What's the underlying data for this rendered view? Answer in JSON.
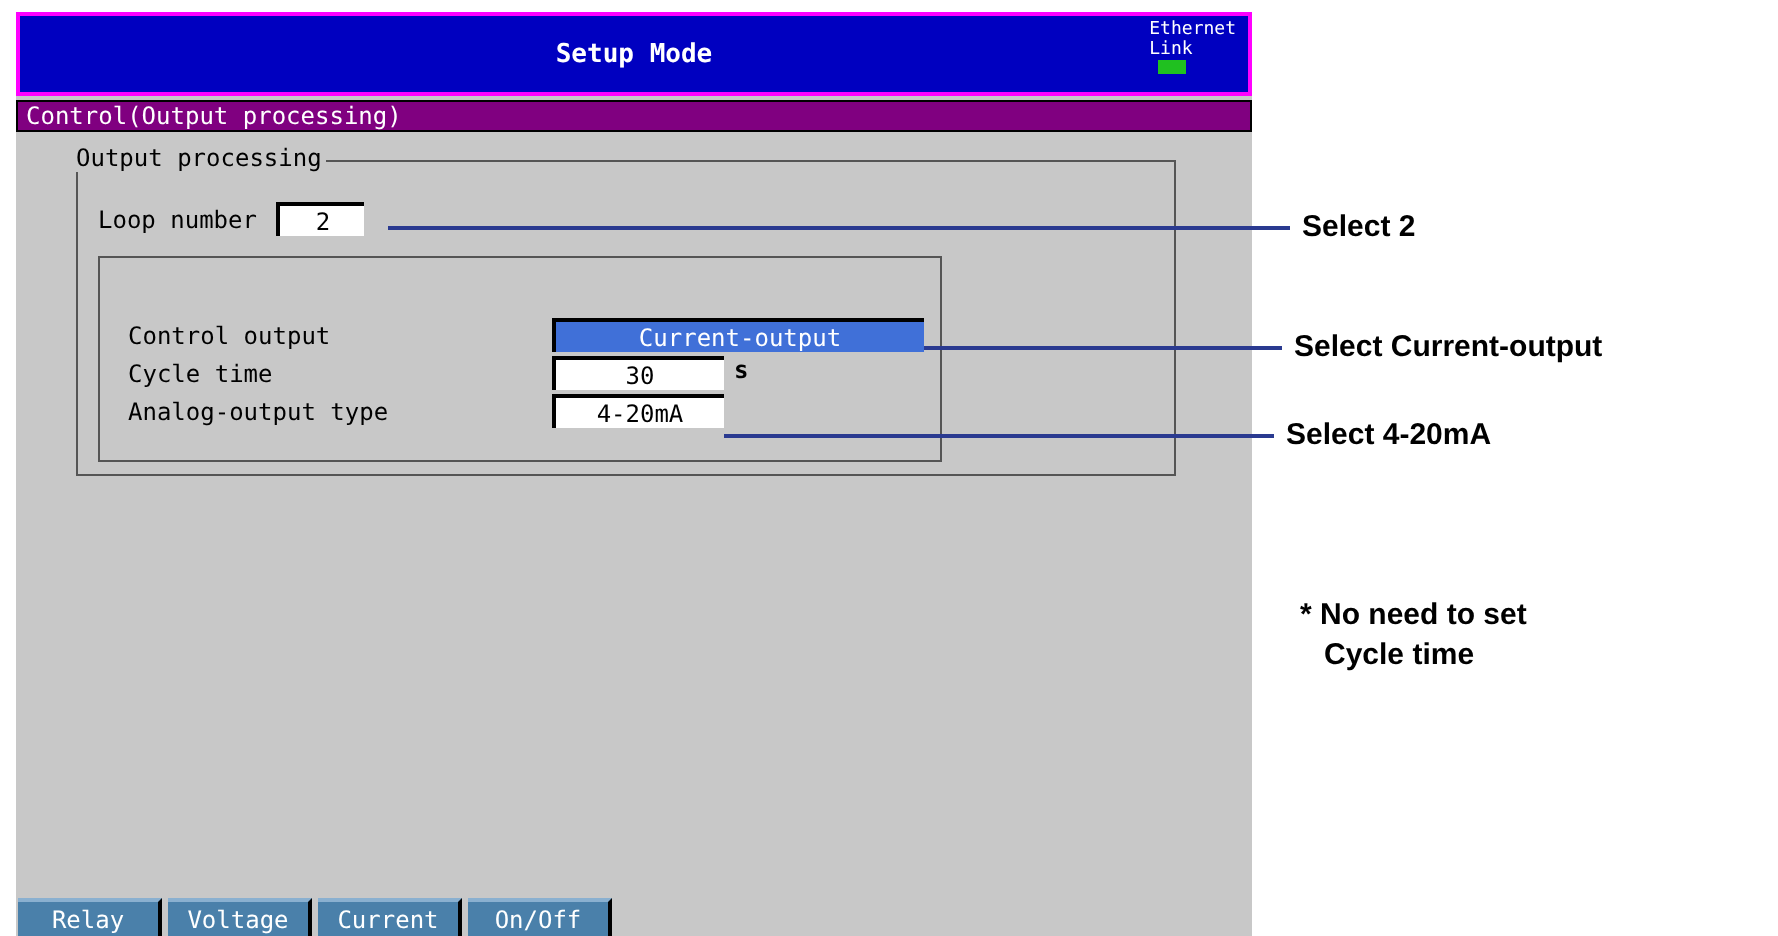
{
  "window": {
    "title": "Setup Mode",
    "link_status": {
      "label_top": "Ethernet",
      "label_bottom": "Link",
      "connected": true
    }
  },
  "section_title": "Control(Output processing)",
  "group": {
    "title": "Output processing",
    "loop_number": {
      "label": "Loop number",
      "value": "2"
    },
    "fields": [
      {
        "label": "Control output",
        "value": "Current-output",
        "selected": true
      },
      {
        "label": "Cycle time",
        "value": "30",
        "unit": "s",
        "selected": false
      },
      {
        "label": "Analog-output type",
        "value": "4-20mA",
        "selected": false
      }
    ]
  },
  "soft_keys": [
    "Relay",
    "Voltage",
    "Current",
    "On/Off"
  ],
  "callouts": [
    {
      "text": "Select 2"
    },
    {
      "text": "Select Current-output"
    },
    {
      "text": "Select 4-20mA"
    }
  ],
  "note": {
    "lines": [
      "* No need to set",
      "Cycle time"
    ]
  }
}
